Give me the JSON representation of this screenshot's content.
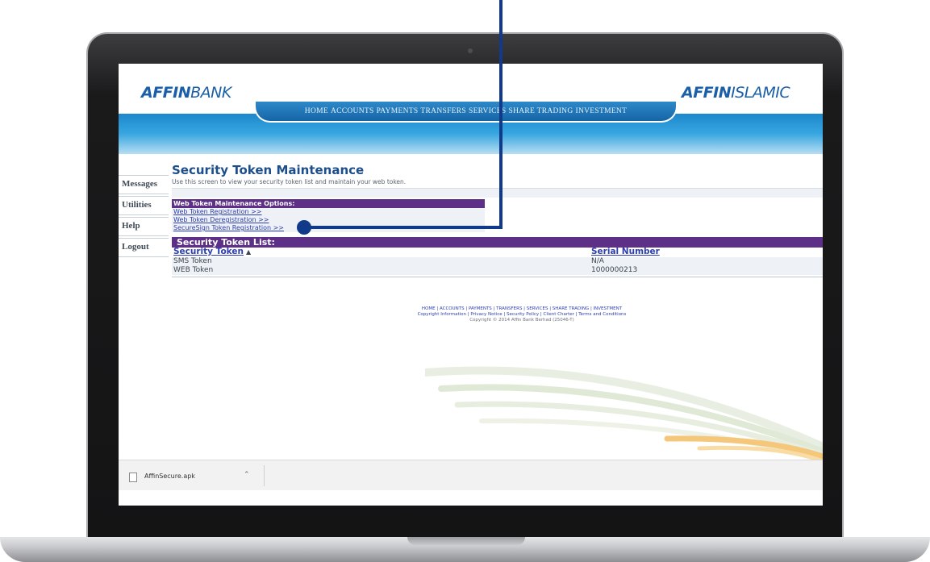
{
  "logos": {
    "left_bold": "AFFIN",
    "left_light": "BANK",
    "right_bold": "AFFIN",
    "right_light": "ISLAMIC"
  },
  "nav": [
    "HOME",
    "ACCOUNTS",
    "PAYMENTS",
    "TRANSFERS",
    "SERVICES",
    "SHARE TRADING",
    "INVESTMENT"
  ],
  "side_menu": [
    "Messages",
    "Utilities",
    "Help",
    "Logout"
  ],
  "page": {
    "title": "Security Token Maintenance",
    "subtitle": "Use this screen to view your security token list and maintain your web token."
  },
  "options": {
    "heading": "Web Token Maintenance Options:",
    "links": [
      "Web Token Registration >>",
      "Web Token Deregistration >>",
      "SecureSign Token Registration >>"
    ]
  },
  "token_list": {
    "heading": "Security Token List:",
    "col_token": "Security Token",
    "col_serial": "Serial Number",
    "rows": [
      {
        "token": "SMS Token",
        "serial": "N/A"
      },
      {
        "token": "WEB Token",
        "serial": "1000000213"
      }
    ]
  },
  "footer": {
    "links_line1": "HOME | ACCOUNTS | PAYMENTS | TRANSFERS | SERVICES | SHARE TRADING | INVESTMENT",
    "links_line2": "Copyright Information | Privacy Notice | Security Policy | Client Charter | Terms and Conditions",
    "copyright": "Copyright © 2014 Affin Bank Berhad (25046-T)"
  },
  "download": {
    "file_name": "AffinSecure.apk"
  },
  "colors": {
    "brand_blue": "#1a5fa8",
    "header_purple": "#5e2f87",
    "callout": "#123a8a"
  }
}
